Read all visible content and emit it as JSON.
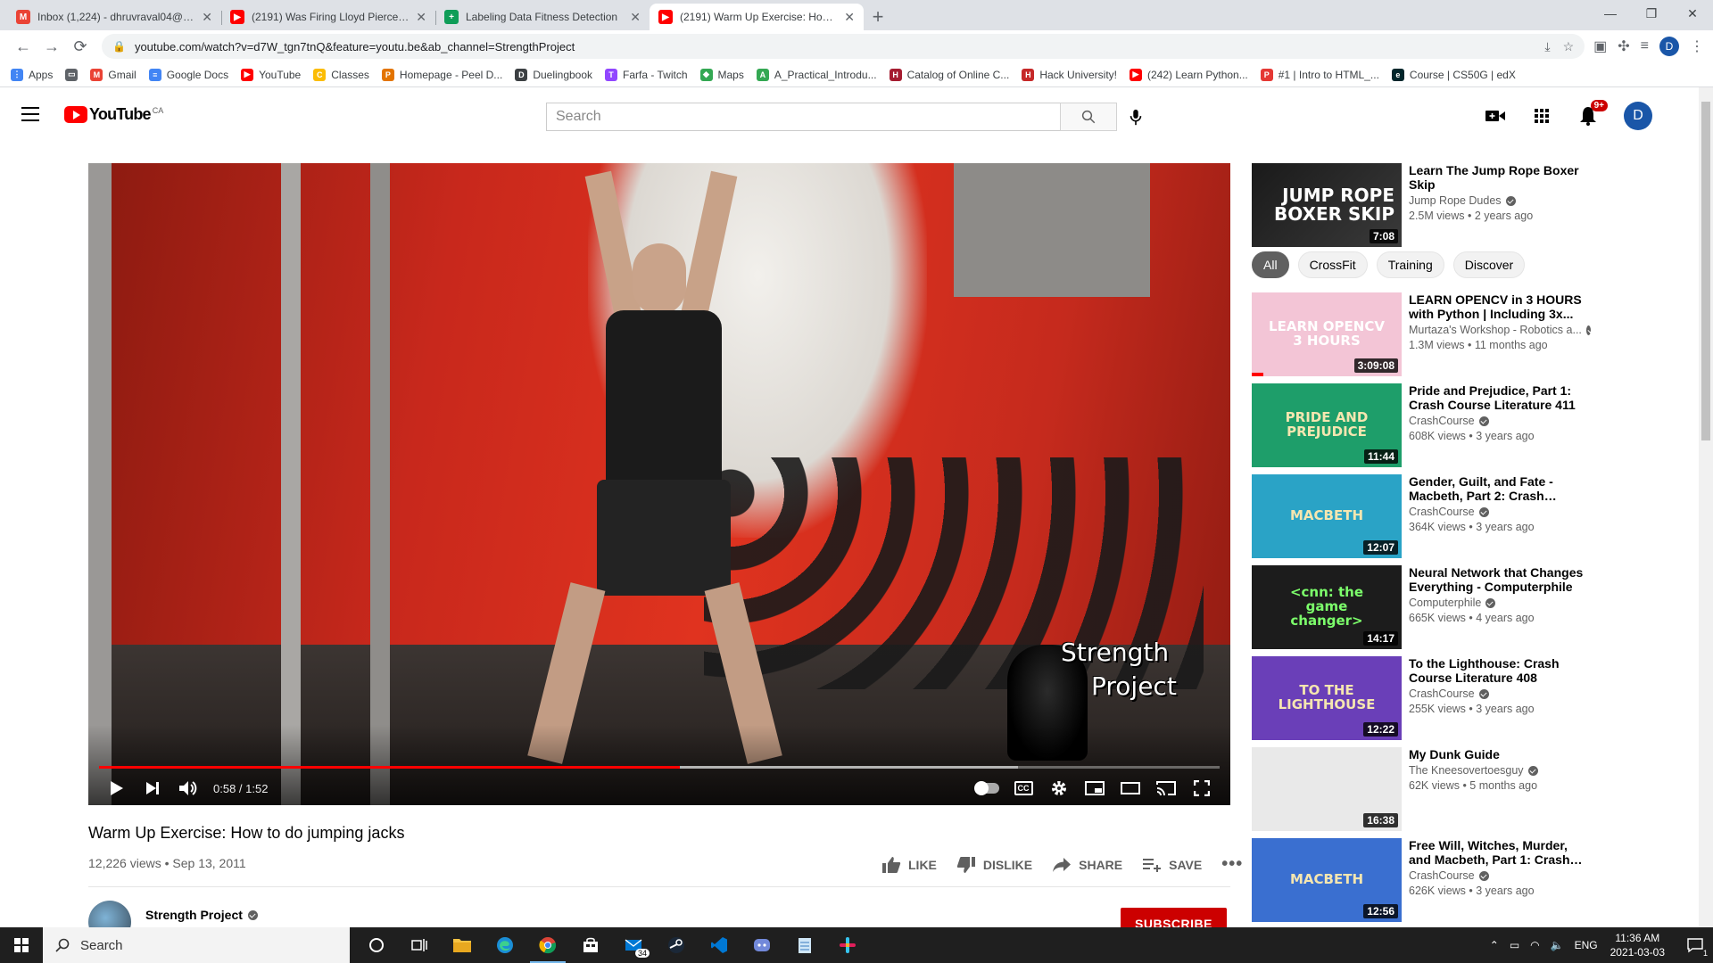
{
  "browser": {
    "tabs": [
      {
        "title": "Inbox (1,224) - dhruvraval04@gmail.com",
        "icon": "gmail-icon",
        "color": "#ea4335",
        "letter": "M"
      },
      {
        "title": "(2191) Was Firing Lloyd Pierce The",
        "icon": "youtube-icon",
        "color": "#ff0000",
        "letter": "▶"
      },
      {
        "title": "Labeling Data Fitness Detection",
        "icon": "sheets-icon",
        "color": "#0f9d58",
        "letter": "+"
      },
      {
        "title": "(2191) Warm Up Exercise: How to do",
        "icon": "youtube-icon",
        "color": "#ff0000",
        "letter": "▶"
      }
    ],
    "url": "youtube.com/watch?v=d7W_tgn7tnQ&feature=youtu.be&ab_channel=StrengthProject",
    "bookmarks": [
      {
        "label": "Apps",
        "color": "#4285f4",
        "letter": "⋮"
      },
      {
        "label": "",
        "color": "#5f6368",
        "letter": "▭"
      },
      {
        "label": "Gmail",
        "color": "#ea4335",
        "letter": "M"
      },
      {
        "label": "Google Docs",
        "color": "#4285f4",
        "letter": "≡"
      },
      {
        "label": "YouTube",
        "color": "#ff0000",
        "letter": "▶"
      },
      {
        "label": "Classes",
        "color": "#fbbc04",
        "letter": "C"
      },
      {
        "label": "Homepage - Peel D...",
        "color": "#e37400",
        "letter": "P"
      },
      {
        "label": "Duelingbook",
        "color": "#3c4043",
        "letter": "D"
      },
      {
        "label": "Farfa - Twitch",
        "color": "#9146ff",
        "letter": "T"
      },
      {
        "label": "Maps",
        "color": "#34a853",
        "letter": "◆"
      },
      {
        "label": "A_Practical_Introdu...",
        "color": "#34a853",
        "letter": "A"
      },
      {
        "label": "Catalog of Online C...",
        "color": "#a51c30",
        "letter": "H"
      },
      {
        "label": "Hack University!",
        "color": "#c62828",
        "letter": "H"
      },
      {
        "label": "(242) Learn Python...",
        "color": "#ff0000",
        "letter": "▶"
      },
      {
        "label": "#1 | Intro to HTML_...",
        "color": "#e53935",
        "letter": "P"
      },
      {
        "label": "Course | CS50G | edX",
        "color": "#02262b",
        "letter": "e"
      }
    ]
  },
  "header": {
    "logo_text": "YouTube",
    "logo_region": "CA",
    "search_placeholder": "Search",
    "notifications": "9+",
    "avatar_letter": "D"
  },
  "player": {
    "current_time": "0:58",
    "duration": "1:52",
    "time_display": "0:58 / 1:52",
    "played_fraction": 0.518,
    "loaded_fraction": 0.82,
    "watermark_line1": "Strength",
    "watermark_line2": "Project"
  },
  "video": {
    "title": "Warm Up Exercise: How to do jumping jacks",
    "meta": "12,226 views • Sep 13, 2011",
    "like_label": "LIKE",
    "dislike_label": "DISLIKE",
    "share_label": "SHARE",
    "save_label": "SAVE",
    "channel_name": "Strength Project",
    "subscribe_label": "SUBSCRIBE"
  },
  "sidebar": {
    "chips": [
      "All",
      "CrossFit",
      "Training",
      "Discover"
    ],
    "top_video": {
      "title": "Learn The Jump Rope Boxer Skip",
      "channel": "Jump Rope Dudes",
      "stats": "2.5M views • 2 years ago",
      "duration": "7:08",
      "thumb_text": "JUMP ROPE BOXER SKIP"
    },
    "videos": [
      {
        "title": "LEARN OPENCV in 3 HOURS with Python | Including 3x...",
        "channel": "Murtaza's Workshop - Robotics a...",
        "stats": "1.3M views • 11 months ago",
        "duration": "3:09:08",
        "thumb_text": "LEARN OPENCV 3 HOURS",
        "bg": "#f3c5d6",
        "fg": "#ffffff",
        "watched": 0.08
      },
      {
        "title": "Pride and Prejudice, Part 1: Crash Course Literature 411",
        "channel": "CrashCourse",
        "stats": "608K views • 3 years ago",
        "duration": "11:44",
        "thumb_text": "PRIDE AND PREJUDICE",
        "bg": "#1e9e6a",
        "fg": "#f5e6b0",
        "watched": 0
      },
      {
        "title": "Gender, Guilt, and Fate - Macbeth, Part 2: Crash Course...",
        "channel": "CrashCourse",
        "stats": "364K views • 3 years ago",
        "duration": "12:07",
        "thumb_text": "MACBETH",
        "bg": "#2aa3c6",
        "fg": "#f5e6b0",
        "watched": 0
      },
      {
        "title": "Neural Network that Changes Everything - Computerphile",
        "channel": "Computerphile",
        "stats": "665K views • 4 years ago",
        "duration": "14:17",
        "thumb_text": "<cnn: the game changer>",
        "bg": "#1c1c1c",
        "fg": "#7cff6b",
        "watched": 0
      },
      {
        "title": "To the Lighthouse: Crash Course Literature 408",
        "channel": "CrashCourse",
        "stats": "255K views • 3 years ago",
        "duration": "12:22",
        "thumb_text": "TO THE LIGHTHOUSE",
        "bg": "#6a3fb8",
        "fg": "#f5e6b0",
        "watched": 0
      },
      {
        "title": "My Dunk Guide",
        "channel": "The Kneesovertoesguy",
        "stats": "62K views • 5 months ago",
        "duration": "16:38",
        "thumb_text": "",
        "bg": "#e9e9e9",
        "fg": "#333333",
        "watched": 0
      },
      {
        "title": "Free Will, Witches, Murder, and Macbeth, Part 1: Crash Course...",
        "channel": "CrashCourse",
        "stats": "626K views • 3 years ago",
        "duration": "12:56",
        "thumb_text": "MACBETH",
        "bg": "#3a6fd0",
        "fg": "#f5e6b0",
        "watched": 0
      }
    ]
  },
  "taskbar": {
    "search_label": "Search",
    "mail_badge": "34",
    "language": "ENG",
    "time": "11:36 AM",
    "date": "2021-03-03",
    "notif_count": "1"
  }
}
